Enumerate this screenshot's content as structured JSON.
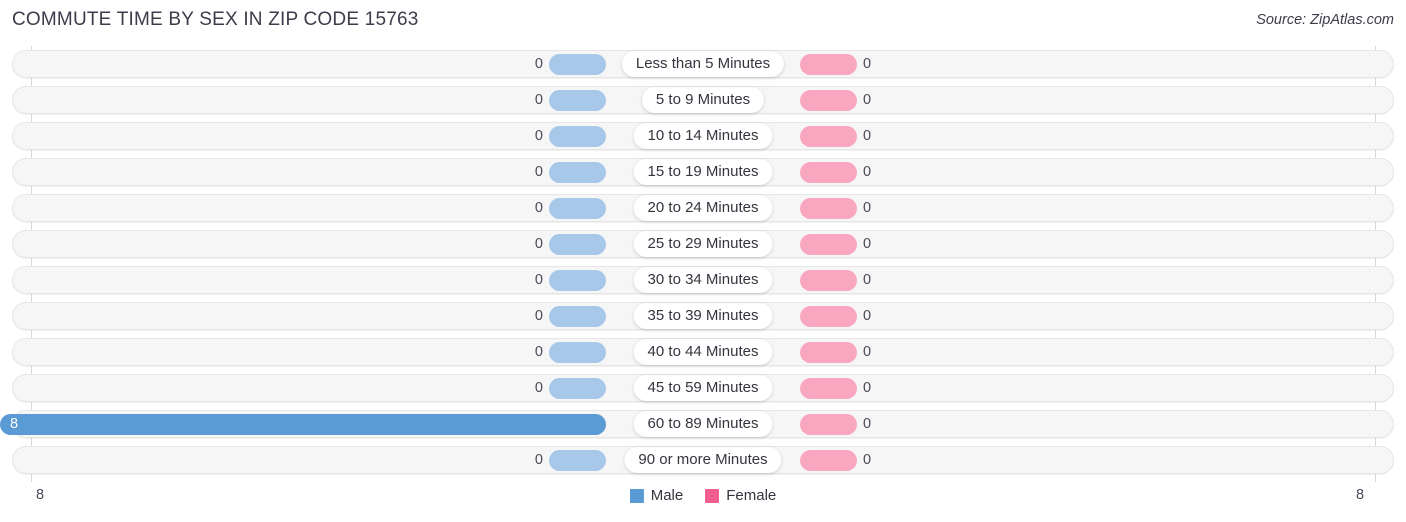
{
  "header": {
    "title": "COMMUTE TIME BY SEX IN ZIP CODE 15763",
    "source": "Source: ZipAtlas.com"
  },
  "axis": {
    "min_label": "8",
    "max_label": "8"
  },
  "legend": {
    "items": [
      {
        "label": "Male",
        "color": "#5b9bd5",
        "icon": "male-swatch"
      },
      {
        "label": "Female",
        "color": "#ee5f8d",
        "icon": "female-swatch"
      }
    ]
  },
  "colors": {
    "male_light": "#a8c8ea",
    "male_strong": "#5b9bd5",
    "female_light": "#f9a7c1",
    "female_strong": "#ee5f8d",
    "track": "#f6f6f6",
    "gridline": "#d9d9de"
  },
  "chart_data": {
    "type": "bar",
    "orientation": "horizontal-diverging",
    "title": "COMMUTE TIME BY SEX IN ZIP CODE 15763",
    "xlabel": "",
    "ylabel": "",
    "xlim": [
      8,
      8
    ],
    "grid": true,
    "legend_position": "bottom-center",
    "categories": [
      "Less than 5 Minutes",
      "5 to 9 Minutes",
      "10 to 14 Minutes",
      "15 to 19 Minutes",
      "20 to 24 Minutes",
      "25 to 29 Minutes",
      "30 to 34 Minutes",
      "35 to 39 Minutes",
      "40 to 44 Minutes",
      "45 to 59 Minutes",
      "60 to 89 Minutes",
      "90 or more Minutes"
    ],
    "series": [
      {
        "name": "Male",
        "values": [
          0,
          0,
          0,
          0,
          0,
          0,
          0,
          0,
          0,
          0,
          8,
          0
        ],
        "labels": [
          "0",
          "0",
          "0",
          "0",
          "0",
          "0",
          "0",
          "0",
          "0",
          "0",
          "8",
          "0"
        ]
      },
      {
        "name": "Female",
        "values": [
          0,
          0,
          0,
          0,
          0,
          0,
          0,
          0,
          0,
          0,
          0,
          0
        ],
        "labels": [
          "0",
          "0",
          "0",
          "0",
          "0",
          "0",
          "0",
          "0",
          "0",
          "0",
          "0",
          "0"
        ]
      }
    ]
  }
}
